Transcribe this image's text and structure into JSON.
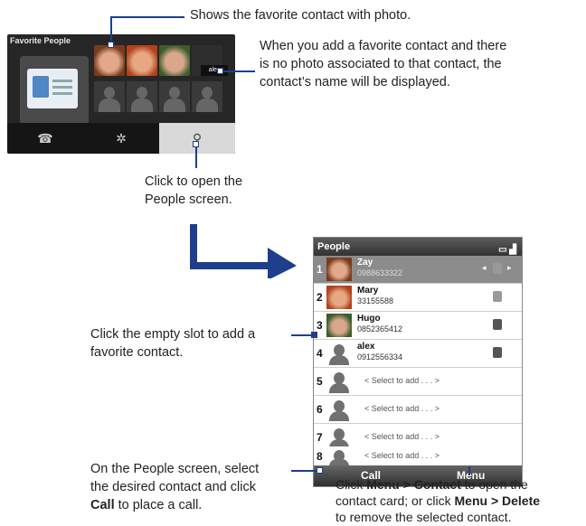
{
  "annotations": {
    "favorite_photo": "Shows the favorite contact with photo.",
    "no_photo_l1": "When you add a favorite contact and there",
    "no_photo_l2": "is no photo associated to that contact, the",
    "no_photo_l3": "contact’s name will be displayed.",
    "open_people_l1": "Click to open the",
    "open_people_l2": "People screen.",
    "empty_slot_l1": "Click the empty slot to add a",
    "empty_slot_l2": "favorite contact.",
    "call_l1": "On the People screen, select",
    "call_l2": "the desired contact and click",
    "call_l3_bold": "Call",
    "call_l3_rest": " to place a call.",
    "menu_l1_pre": "Click ",
    "menu_l1_bold": "Menu > Contact",
    "menu_l1_post": " to open the",
    "menu_l2_pre": "contact card; or click ",
    "menu_l2_bold": "Menu > Delete",
    "menu_l3": "to remove the selected contact."
  },
  "favorite_widget": {
    "title": "Favorite People",
    "name_tag": "alex",
    "tabs": [
      "☎",
      "✲",
      "⚲"
    ]
  },
  "people_screen": {
    "title": "People",
    "battery": "▭ ▟",
    "contacts": [
      {
        "num": "1",
        "name": "Zay",
        "phone": "0988633322"
      },
      {
        "num": "2",
        "name": "Mary",
        "phone": "33155588"
      },
      {
        "num": "3",
        "name": "Hugo",
        "phone": "0852365412"
      },
      {
        "num": "4",
        "name": "alex",
        "phone": "0912556334"
      },
      {
        "num": "5",
        "add": "< Select to add . . . >"
      },
      {
        "num": "6",
        "add": "< Select to add . . . >"
      },
      {
        "num": "7",
        "add": "< Select to add . . . >"
      },
      {
        "num": "8",
        "add": "< Select to add . . . >"
      }
    ],
    "softkey_left": "Call",
    "softkey_right": "Menu"
  }
}
